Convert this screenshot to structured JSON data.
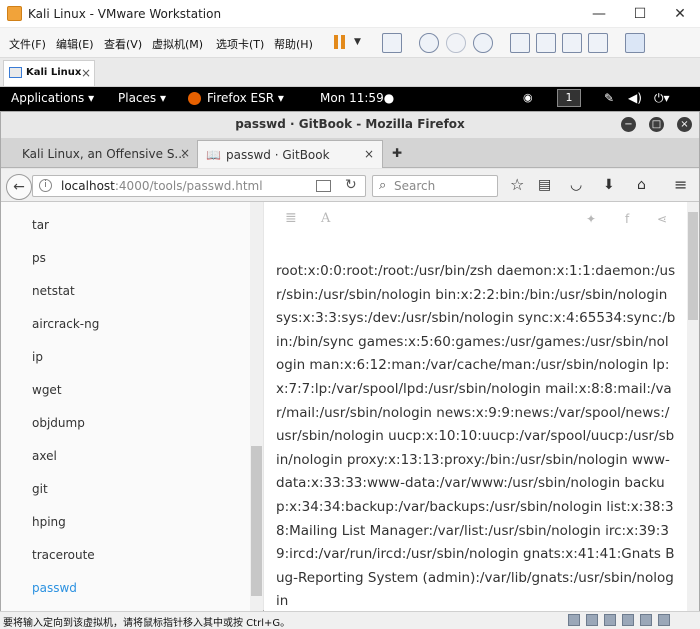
{
  "vmware": {
    "title": "Kali Linux - VMware Workstation",
    "window_controls": [
      "—",
      "☐",
      "✕"
    ],
    "menu": [
      "文件(F)",
      "编辑(E)",
      "查看(V)",
      "虚拟机(M)",
      "选项卡(T)",
      "帮助(H)"
    ],
    "tab": {
      "label": "Kali Linux",
      "close": "×"
    },
    "status_message": "要将输入定向到该虚拟机，请将鼠标指针移入其中或按 Ctrl+G。"
  },
  "gnome": {
    "applications": "Applications ▾",
    "places": "Places ▾",
    "firefox": "Firefox ESR ▾",
    "clock": "Mon 11:59●",
    "workspace": "1"
  },
  "firefox": {
    "window_title": "passwd · GitBook - Mozilla Firefox",
    "tabs": [
      {
        "label": "Kali Linux, an Offensive S...",
        "close": "×"
      },
      {
        "label": "passwd · GitBook",
        "close": "×"
      }
    ],
    "new_tab": "✚",
    "url_host": "localhost",
    "url_rest": ":4000/tools/passwd.html",
    "search_placeholder": "Search"
  },
  "sidebar": {
    "items": [
      "tar",
      "ps",
      "netstat",
      "aircrack-ng",
      "ip",
      "wget",
      "objdump",
      "axel",
      "git",
      "hping",
      "traceroute",
      "passwd"
    ],
    "active": "passwd"
  },
  "content": {
    "text": "root:x:0:0:root:/root:/usr/bin/zsh daemon:x:1:1:daemon:/usr/sbin:/usr/sbin/nologin bin:x:2:2:bin:/bin:/usr/sbin/nologin sys:x:3:3:sys:/dev:/usr/sbin/nologin sync:x:4:65534:sync:/bin:/bin/sync games:x:5:60:games:/usr/games:/usr/sbin/nologin man:x:6:12:man:/var/cache/man:/usr/sbin/nologin lp:x:7:7:lp:/var/spool/lpd:/usr/sbin/nologin mail:x:8:8:mail:/var/mail:/usr/sbin/nologin news:x:9:9:news:/var/spool/news:/usr/sbin/nologin uucp:x:10:10:uucp:/var/spool/uucp:/usr/sbin/nologin proxy:x:13:13:proxy:/bin:/usr/sbin/nologin www-data:x:33:33:www-data:/var/www:/usr/sbin/nologin backup:x:34:34:backup:/var/backups:/usr/sbin/nologin list:x:38:38:Mailing List Manager:/var/list:/usr/sbin/nologin irc:x:39:39:ircd:/var/run/ircd:/usr/sbin/nologin gnats:x:41:41:Gnats Bug-Reporting System (admin):/var/lib/gnats:/usr/sbin/nologin"
  },
  "colors": {
    "link_active": "#2b91e0",
    "gnome_bar": "#000000",
    "vmware_accent": "#e38a1b"
  }
}
